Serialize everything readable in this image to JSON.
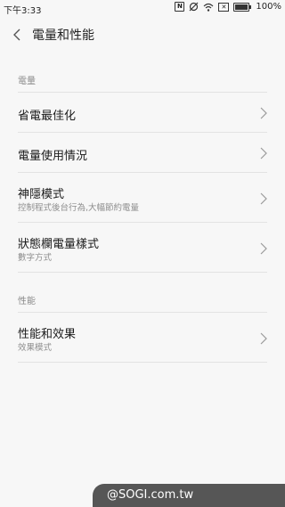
{
  "status_bar": {
    "time": "下午3:33",
    "icons": [
      "nfc-icon",
      "mute-icon",
      "wifi-icon",
      "close-box-icon",
      "battery-icon"
    ],
    "battery_text": "100%",
    "battery_level": 1.0
  },
  "header": {
    "title": "電量和性能",
    "back_icon": "chevron-left-icon"
  },
  "sections": {
    "power": {
      "label": "電量",
      "items": [
        {
          "title": "省電最佳化"
        },
        {
          "title": "電量使用情況"
        },
        {
          "title": "神隱模式",
          "subtitle": "控制程式後台行為,大幅節約電量"
        },
        {
          "title": "狀態欄電量樣式",
          "subtitle": "數字方式"
        }
      ]
    },
    "performance": {
      "label": "性能",
      "items": [
        {
          "title": "性能和效果",
          "subtitle": "效果模式"
        }
      ]
    }
  },
  "watermark": "@SOGI.com.tw",
  "colors": {
    "background": "#f7f7f7",
    "divider": "#e3e3e3",
    "secondary_text": "#8e8e8e",
    "watermark_bg": "#565656"
  }
}
